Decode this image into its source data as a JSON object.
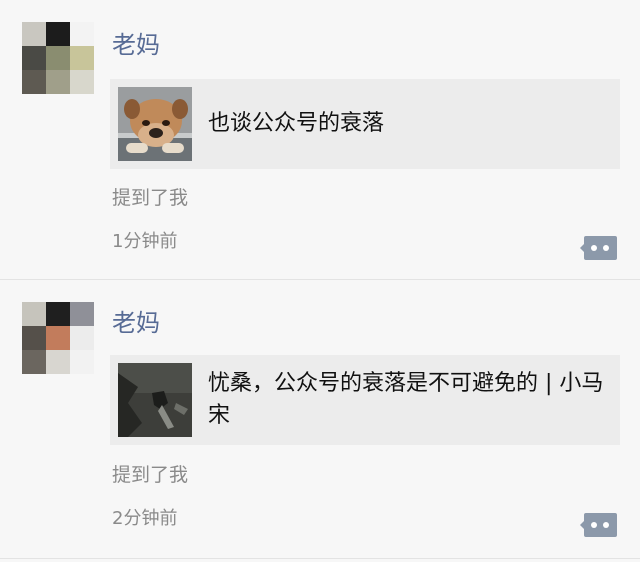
{
  "notifications": [
    {
      "name": "老妈",
      "link_title": "也谈公众号的衰落",
      "mention": "提到了我",
      "time": "1分钟前",
      "thumbnail": "bulldog-photo"
    },
    {
      "name": "老妈",
      "link_title": "忧桑，公众号的衰落是不可避免的 | 小马宋",
      "mention": "提到了我",
      "time": "2分钟前",
      "thumbnail": "dark-scene-photo"
    }
  ],
  "icons": {
    "comment": "comment-bubble-icon"
  },
  "colors": {
    "background": "#f7f7f7",
    "name": "#576b95",
    "card_bg": "#ececec",
    "meta_text": "#8a8a8a",
    "icon": "#8c99aa",
    "divider": "#e3e3e3"
  }
}
